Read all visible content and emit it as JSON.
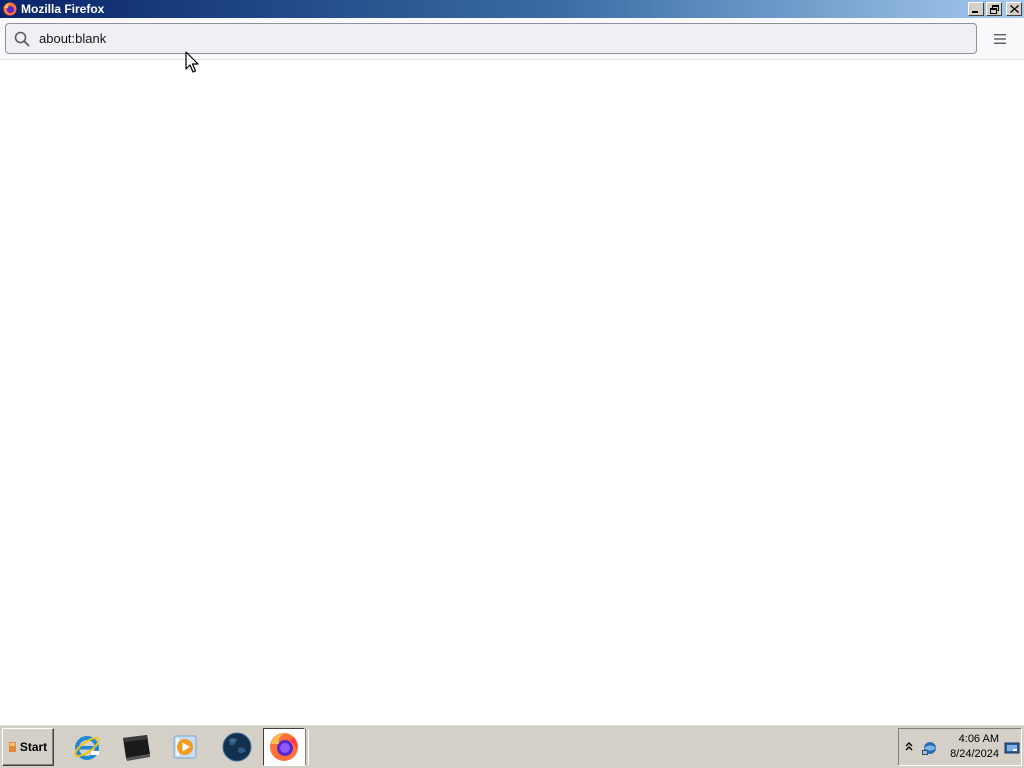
{
  "window": {
    "title": "Mozilla Firefox",
    "controls": [
      "minimize",
      "restore",
      "close"
    ]
  },
  "toolbar": {
    "url_value": "about:blank",
    "icons": {
      "search": "search-icon",
      "menu": "hamburger-menu-icon"
    }
  },
  "taskbar": {
    "start_label": "Start",
    "items": [
      {
        "name": "internet-explorer",
        "icon": "internet-explorer-icon",
        "active": false
      },
      {
        "name": "terminal",
        "icon": "terminal-icon",
        "active": false
      },
      {
        "name": "media-player",
        "icon": "media-player-icon",
        "active": false
      },
      {
        "name": "network-globe",
        "icon": "globe-icon",
        "active": false
      },
      {
        "name": "firefox",
        "icon": "firefox-icon",
        "active": true
      }
    ],
    "tray": {
      "time": "4:06 AM",
      "date": "8/24/2024"
    }
  },
  "colors": {
    "titlebar_start": "#0a246a",
    "titlebar_end": "#a6caf0",
    "taskbar": "#d4d0c8",
    "urlbar_bg": "#f0f0f4"
  }
}
